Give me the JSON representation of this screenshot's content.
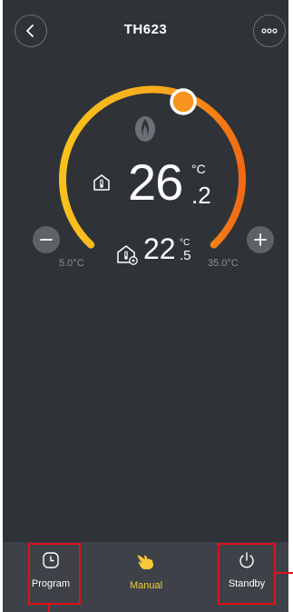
{
  "header": {
    "title": "TH623",
    "back_icon": "chevron-left-icon",
    "more_icon": "more-horizontal-icon"
  },
  "thermostat": {
    "current_temp_int": "26",
    "current_temp_dec": ".2",
    "current_unit": "°C",
    "set_temp_int": "22",
    "set_temp_dec": ".5",
    "set_unit": "°C",
    "min_label": "5.0°C",
    "max_label": "35.0°C",
    "arc_start_color": "#f9c21c",
    "arc_end_color": "#f26a13",
    "knob_color": "#f7931e"
  },
  "modes": [
    {
      "label": "Program",
      "icon": "clock-icon",
      "color": "#ffffff"
    },
    {
      "label": "Manual",
      "icon": "hand-pointer-icon",
      "color": "#f7c83a"
    },
    {
      "label": "Standby",
      "icon": "power-icon",
      "color": "#ffffff"
    }
  ],
  "annotation_color": "#e0101c"
}
